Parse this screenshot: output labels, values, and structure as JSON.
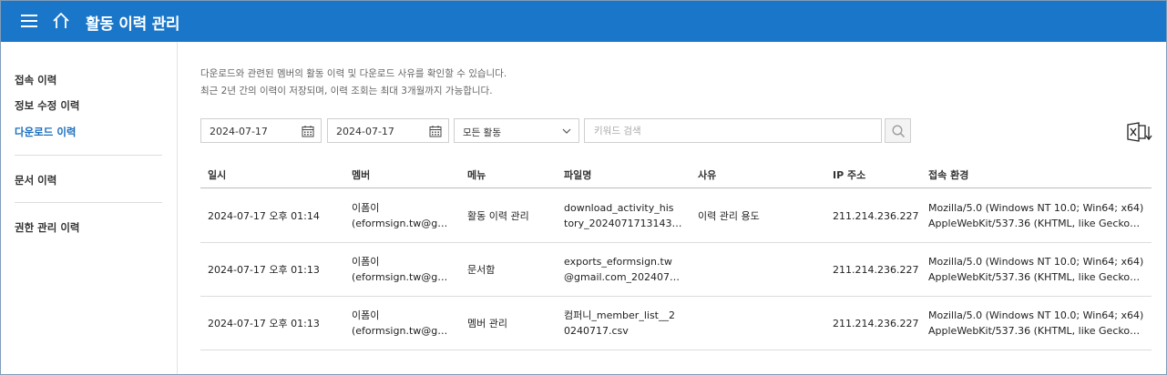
{
  "header": {
    "title": "활동 이력 관리"
  },
  "sidebar": {
    "items": [
      {
        "label": "접속 이력"
      },
      {
        "label": "정보 수정 이력"
      },
      {
        "label": "다운로드 이력"
      },
      {
        "label": "문서 이력"
      },
      {
        "label": "권한 관리 이력"
      }
    ],
    "active_index": 2
  },
  "description": {
    "line1": "다운로드와 관련된 멤버의 활동 이력 및 다운로드 사유를 확인할 수 있습니다.",
    "line2": "최근 2년 간의 이력이 저장되며, 이력 조회는 최대 3개월까지 가능합니다."
  },
  "filters": {
    "start_date": "2024-07-17",
    "end_date": "2024-07-17",
    "activity_select": "모든 활동",
    "search_placeholder": "키워드 검색"
  },
  "table": {
    "columns": [
      "일시",
      "멤버",
      "메뉴",
      "파일명",
      "사유",
      "IP 주소",
      "접속 환경"
    ],
    "rows": [
      {
        "datetime": "2024-07-17 오후 01:14",
        "member_line1": "이폼이",
        "member_line2": "(eformsign.tw@g…",
        "menu": "활동 이력 관리",
        "file_line1": "download_activity_his",
        "file_line2": "tory_2024071713143…",
        "reason": "이력 관리 용도",
        "ip": "211.214.236.227",
        "env_line1": "Mozilla/5.0 (Windows NT 10.0; Win64; x64)",
        "env_line2": "AppleWebKit/537.36 (KHTML, like Gecko…"
      },
      {
        "datetime": "2024-07-17 오후 01:13",
        "member_line1": "이폼이",
        "member_line2": "(eformsign.tw@g…",
        "menu": "문서함",
        "file_line1": "exports_eformsign.tw",
        "file_line2": "@gmail.com_202407…",
        "reason": "",
        "ip": "211.214.236.227",
        "env_line1": "Mozilla/5.0 (Windows NT 10.0; Win64; x64)",
        "env_line2": "AppleWebKit/537.36 (KHTML, like Gecko…"
      },
      {
        "datetime": "2024-07-17 오후 01:13",
        "member_line1": "이폼이",
        "member_line2": "(eformsign.tw@g…",
        "menu": "멤버 관리",
        "file_line1": "컴퍼니_member_list__2",
        "file_line2": "0240717.csv",
        "reason": "",
        "ip": "211.214.236.227",
        "env_line1": "Mozilla/5.0 (Windows NT 10.0; Win64; x64)",
        "env_line2": "AppleWebKit/537.36 (KHTML, like Gecko…"
      }
    ]
  },
  "icons": {
    "menu": "hamburger-icon",
    "home": "home-icon",
    "calendar": "calendar-icon",
    "dropdown": "chevron-down-icon",
    "search": "search-icon",
    "excel_download": "excel-download-icon"
  },
  "colors": {
    "brand": "#1a76c9",
    "active_link": "#1a6dbd"
  }
}
